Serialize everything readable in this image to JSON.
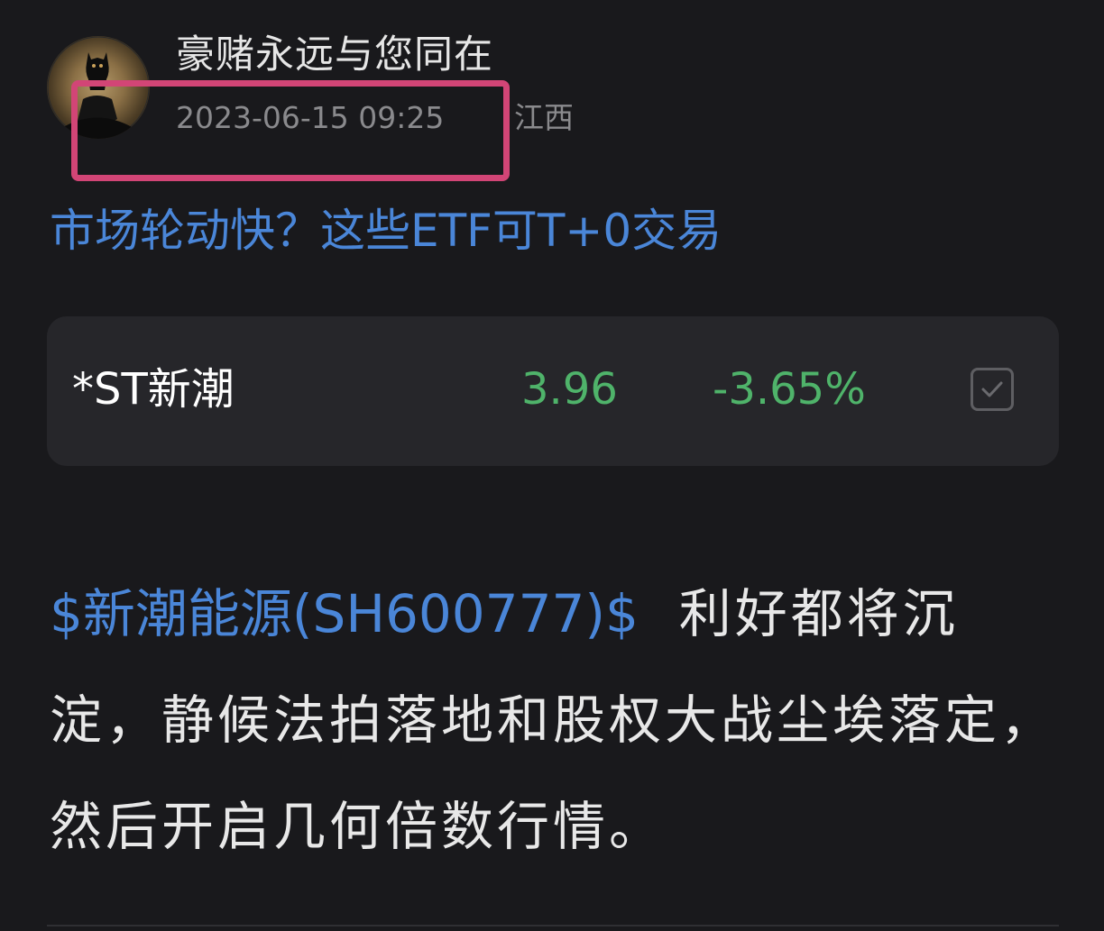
{
  "post": {
    "author": "豪赌永远与您同在",
    "timestamp": "2023-06-15 09:25",
    "location": "江西",
    "headline_link": "市场轮动快？这些ETF可T+0交易"
  },
  "stock_card": {
    "name": "*ST新潮",
    "price": "3.96",
    "change": "-3.65%"
  },
  "content": {
    "stock_link": "$新潮能源(SH600777)$",
    "text": "利好都将沉淀，静候法拍落地和股权大战尘埃落定，然后开启几何倍数行情。"
  },
  "colors": {
    "background": "#19191c",
    "link": "#4a86d8",
    "down_green": "#4fb36a",
    "highlight": "#d24576"
  },
  "icons": {
    "avatar": "avatar",
    "watchlist": "checkbox-check-icon"
  }
}
